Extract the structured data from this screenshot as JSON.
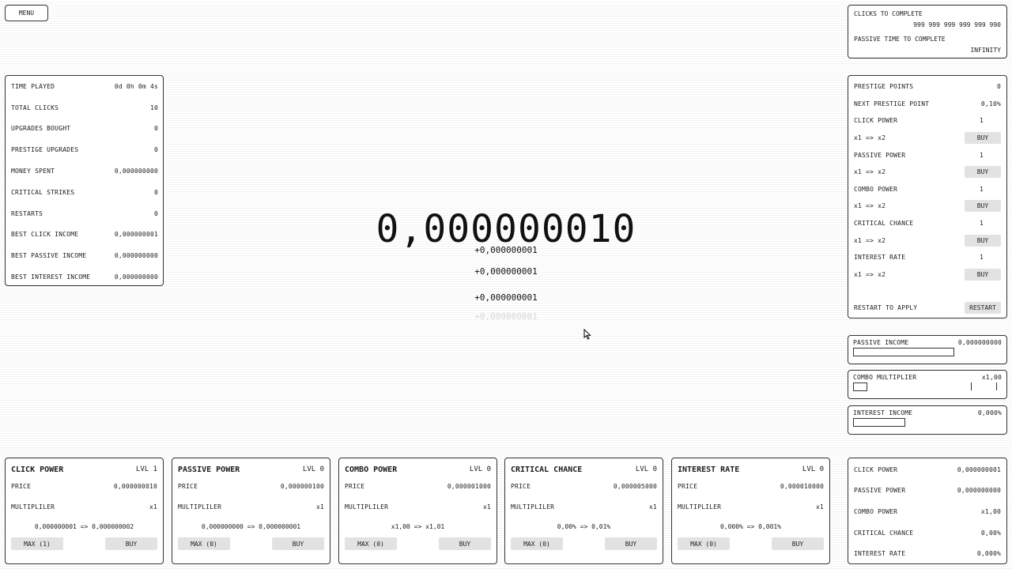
{
  "menu": {
    "label": "MENU"
  },
  "stats": [
    {
      "label": "TIME PLAYED",
      "value": "0d 0h 0m 4s"
    },
    {
      "label": "TOTAL CLICKS",
      "value": "10"
    },
    {
      "label": "UPGRADES BOUGHT",
      "value": "0"
    },
    {
      "label": "PRESTIGE UPGRADES",
      "value": "0"
    },
    {
      "label": "MONEY SPENT",
      "value": "0,000000000"
    },
    {
      "label": "CRITICAL STRIKES",
      "value": "0"
    },
    {
      "label": "RESTARTS",
      "value": "0"
    },
    {
      "label": "BEST CLICK INCOME",
      "value": "0,000000001"
    },
    {
      "label": "BEST PASSIVE INCOME",
      "value": "0,000000000"
    },
    {
      "label": "BEST INTEREST INCOME",
      "value": "0,000000000"
    }
  ],
  "complete": {
    "clicks_label": "CLICKS TO COMPLETE",
    "clicks_value": "999 999 999 999 999 990",
    "passive_label": "PASSIVE TIME TO COMPLETE",
    "passive_value": "INFINITY"
  },
  "prestige": {
    "points_label": "PRESTIGE POINTS",
    "points_value": "0",
    "next_label": "NEXT PRESTIGE POINT",
    "next_value": "0,10%",
    "upgrades": [
      {
        "label": "CLICK POWER",
        "level": "1",
        "change": "x1 => x2",
        "buy": "BUY"
      },
      {
        "label": "PASSIVE POWER",
        "level": "1",
        "change": "x1 => x2",
        "buy": "BUY"
      },
      {
        "label": "COMBO POWER",
        "level": "1",
        "change": "x1 => x2",
        "buy": "BUY"
      },
      {
        "label": "CRITICAL CHANCE",
        "level": "1",
        "change": "x1 => x2",
        "buy": "BUY"
      },
      {
        "label": "INTEREST RATE",
        "level": "1",
        "change": "x1 => x2",
        "buy": "BUY"
      }
    ],
    "restart_label": "RESTART TO APPLY",
    "restart_button": "RESTART"
  },
  "meters": [
    {
      "label": "PASSIVE INCOME",
      "value": "0,000000000",
      "fill": 0.0
    },
    {
      "label": "COMBO MULTIPLIER",
      "value": "x1,00",
      "fill": 0.0
    },
    {
      "label": "INTEREST INCOME",
      "value": "0,000%",
      "fill": 0.0
    }
  ],
  "counter": "0,000000010",
  "floats": [
    "+0,000000001",
    "+0,000000001",
    "+0,000000001",
    "+0,000000001"
  ],
  "cards": [
    {
      "title": "CLICK POWER",
      "lvl": "LVL 1",
      "price_label": "PRICE",
      "price": "0,000000010",
      "mult_label": "MULTIPLILER",
      "mult": "x1",
      "change": "0,000000001 => 0,000000002",
      "max": "MAX (1)",
      "buy": "BUY"
    },
    {
      "title": "PASSIVE POWER",
      "lvl": "LVL 0",
      "price_label": "PRICE",
      "price": "0,000000100",
      "mult_label": "MULTIPLILER",
      "mult": "x1",
      "change": "0,000000000 => 0,000000001",
      "max": "MAX (0)",
      "buy": "BUY"
    },
    {
      "title": "COMBO POWER",
      "lvl": "LVL 0",
      "price_label": "PRICE",
      "price": "0,000001000",
      "mult_label": "MULTIPLILER",
      "mult": "x1",
      "change": "x1,00 => x1,01",
      "max": "MAX (0)",
      "buy": "BUY"
    },
    {
      "title": "CRITICAL CHANCE",
      "lvl": "LVL 0",
      "price_label": "PRICE",
      "price": "0,000005000",
      "mult_label": "MULTIPLILER",
      "mult": "x1",
      "change": "0,00% => 0,01%",
      "max": "MAX (0)",
      "buy": "BUY"
    },
    {
      "title": "INTEREST RATE",
      "lvl": "LVL 0",
      "price_label": "PRICE",
      "price": "0,000010000",
      "mult_label": "MULTIPLILER",
      "mult": "x1",
      "change": "0,000% => 0,001%",
      "max": "MAX (0)",
      "buy": "BUY"
    }
  ],
  "summary": [
    {
      "label": "CLICK POWER",
      "value": "0,000000001"
    },
    {
      "label": "PASSIVE POWER",
      "value": "0,000000000"
    },
    {
      "label": "COMBO POWER",
      "value": "x1,00"
    },
    {
      "label": "CRITICAL CHANCE",
      "value": "0,00%"
    },
    {
      "label": "INTEREST RATE",
      "value": "0,000%"
    }
  ]
}
